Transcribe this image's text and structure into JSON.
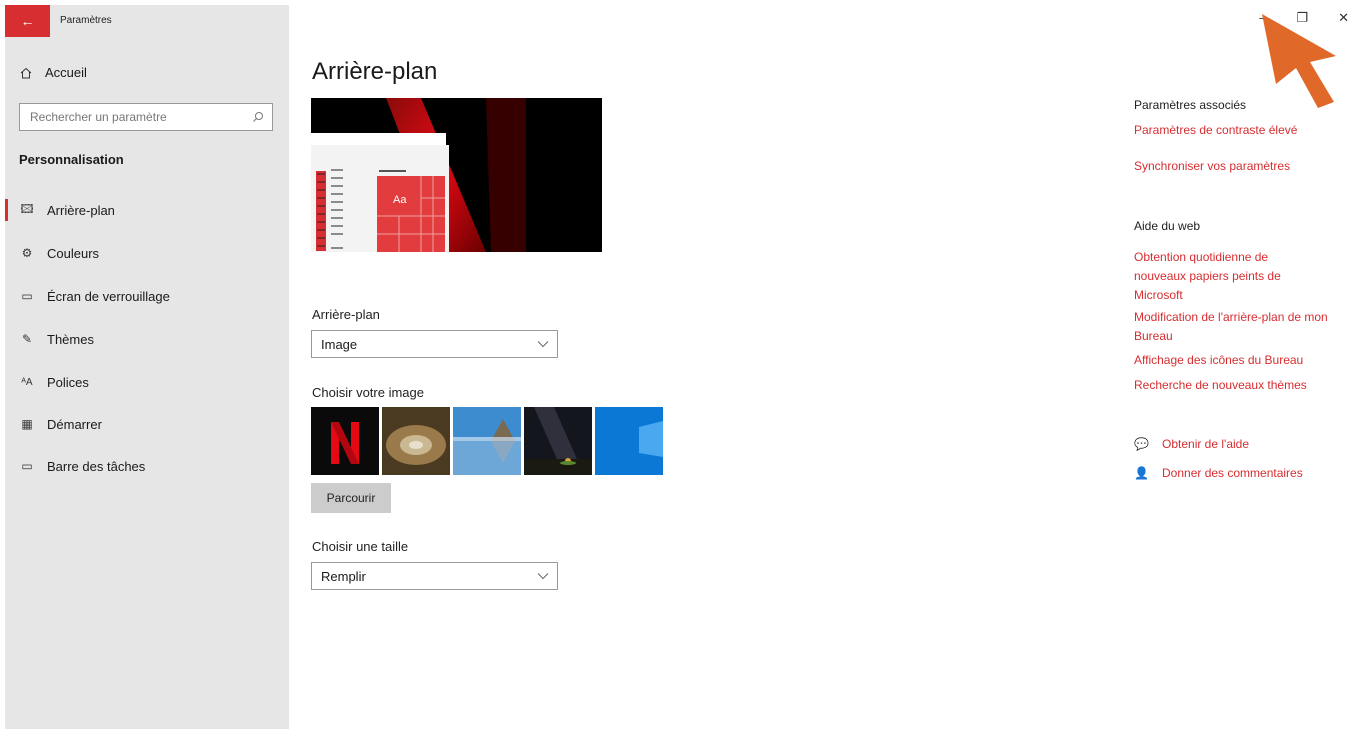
{
  "window": {
    "title": "Paramètres",
    "controls": [
      "–",
      "❐",
      "✕"
    ]
  },
  "sidebar": {
    "home": "Accueil",
    "search_placeholder": "Rechercher un paramètre",
    "section": "Personnalisation",
    "items": [
      {
        "label": "Arrière-plan",
        "icon": "picture-icon",
        "active": true
      },
      {
        "label": "Couleurs",
        "icon": "palette-icon"
      },
      {
        "label": "Écran de verrouillage",
        "icon": "lockscreen-icon"
      },
      {
        "label": "Thèmes",
        "icon": "themes-icon"
      },
      {
        "label": "Polices",
        "icon": "fonts-icon"
      },
      {
        "label": "Démarrer",
        "icon": "start-icon"
      },
      {
        "label": "Barre des tâches",
        "icon": "taskbar-icon"
      }
    ]
  },
  "main": {
    "title": "Arrière-plan",
    "preview_tile_text": "Aa",
    "background_label": "Arrière-plan",
    "background_value": "Image",
    "choose_image_label": "Choisir votre image",
    "browse_label": "Parcourir",
    "size_label": "Choisir une taille",
    "size_value": "Remplir"
  },
  "right": {
    "related_title": "Paramètres associés",
    "related_links": [
      "Paramètres de contraste élevé",
      "Synchroniser vos paramètres"
    ],
    "web_title": "Aide du web",
    "web_links": [
      "Obtention quotidienne de nouveaux papiers peints de Microsoft",
      "Modification de l'arrière-plan de mon Bureau",
      "Affichage des icônes du Bureau",
      "Recherche de nouveaux thèmes"
    ],
    "help": "Obtenir de l'aide",
    "feedback": "Donner des commentaires"
  },
  "colors": {
    "accent": "#d62e31",
    "sidebar_bg": "#e6e6e6",
    "cursor": "#e0692a"
  }
}
